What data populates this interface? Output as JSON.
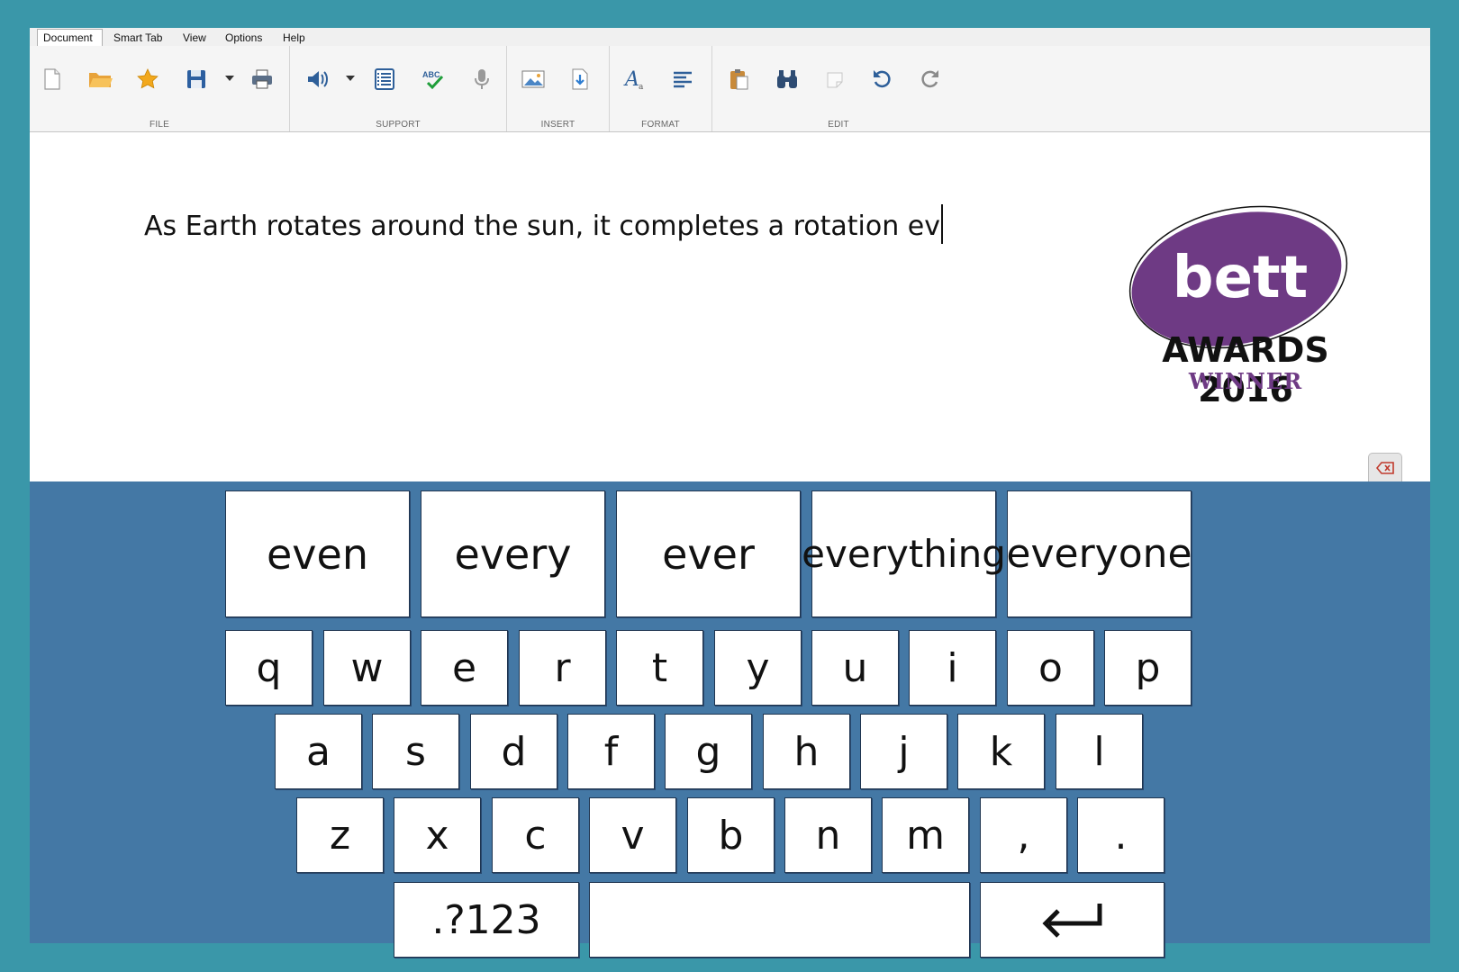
{
  "tabs": [
    {
      "label": "Document",
      "active": true
    },
    {
      "label": "Smart Tab",
      "active": false
    },
    {
      "label": "View",
      "active": false
    },
    {
      "label": "Options",
      "active": false
    },
    {
      "label": "Help",
      "active": false
    }
  ],
  "ribbon": {
    "groups": [
      {
        "label": "FILE",
        "icons": [
          "new-document-icon",
          "open-folder-icon",
          "favorite-star-icon",
          "save-icon",
          "save-dropdown-icon",
          "print-icon"
        ]
      },
      {
        "label": "SUPPORT",
        "icons": [
          "speak-icon",
          "speak-dropdown-icon",
          "word-list-icon",
          "spellcheck-icon",
          "microphone-icon"
        ]
      },
      {
        "label": "INSERT",
        "icons": [
          "insert-image-icon",
          "insert-file-icon"
        ]
      },
      {
        "label": "FORMAT",
        "icons": [
          "font-icon",
          "align-left-icon"
        ]
      },
      {
        "label": "EDIT",
        "icons": [
          "paste-icon",
          "find-icon",
          "clear-icon",
          "undo-icon",
          "redo-icon"
        ]
      }
    ]
  },
  "document": {
    "text": "As Earth rotates around the sun, it completes a rotation ev"
  },
  "badge": {
    "logo_text": "bett",
    "awards_text": "AWARDS 2016",
    "winner_text": "WINNER",
    "colors": {
      "purple": "#6e3a84",
      "dark": "#111111"
    }
  },
  "keyboard": {
    "predictions": [
      "even",
      "every",
      "ever",
      "everything",
      "everyone"
    ],
    "row1": [
      "q",
      "w",
      "e",
      "r",
      "t",
      "y",
      "u",
      "i",
      "o",
      "p"
    ],
    "row2": [
      "a",
      "s",
      "d",
      "f",
      "g",
      "h",
      "j",
      "k",
      "l"
    ],
    "row3": [
      "z",
      "x",
      "c",
      "v",
      "b",
      "n",
      "m",
      ",",
      "."
    ],
    "symbols_label": ".?123",
    "space_label": "",
    "enter_icon": "enter-arrow-icon",
    "toggle_icon": "backspace-keyboard-icon"
  },
  "colors": {
    "frame": "#3a97a9",
    "keyboard_bg": "#4478a5",
    "ribbon_bg": "#f5f5f5"
  }
}
